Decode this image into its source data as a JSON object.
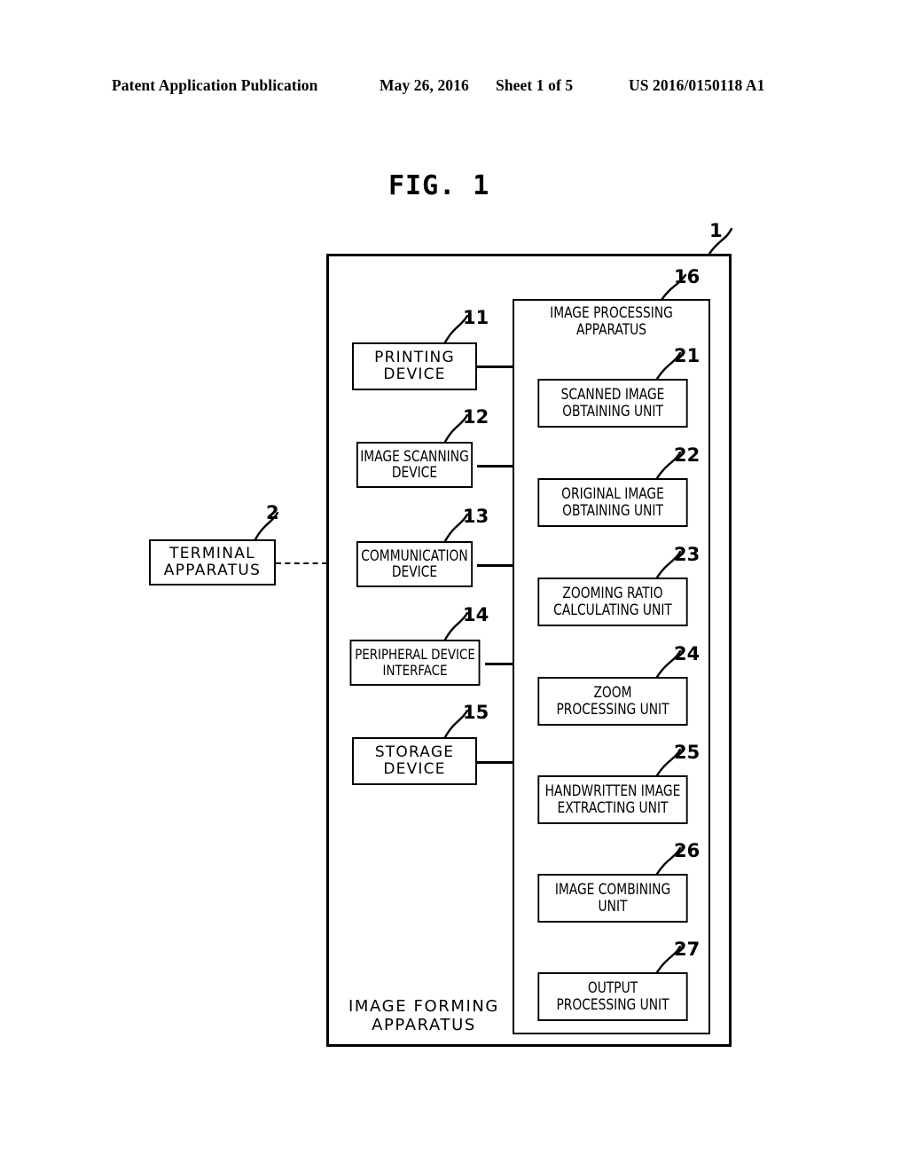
{
  "header": {
    "left": "Patent Application Publication",
    "date": "May 26, 2016",
    "sheet": "Sheet 1 of 5",
    "pub_number": "US 2016/0150118 A1"
  },
  "figure": {
    "title": "FIG. 1"
  },
  "diagram": {
    "outer": {
      "ref": "1",
      "label": "IMAGE FORMING\nAPPARATUS"
    },
    "terminal": {
      "ref": "2",
      "label": "TERMINAL\nAPPARATUS"
    },
    "image_processing_apparatus": {
      "ref": "16",
      "label": "IMAGE PROCESSING\nAPPARATUS"
    },
    "devices": [
      {
        "ref": "11",
        "label": "PRINTING\nDEVICE"
      },
      {
        "ref": "12",
        "label": "IMAGE SCANNING\nDEVICE"
      },
      {
        "ref": "13",
        "label": "COMMUNICATION\nDEVICE"
      },
      {
        "ref": "14",
        "label": "PERIPHERAL DEVICE\nINTERFACE"
      },
      {
        "ref": "15",
        "label": "STORAGE\nDEVICE"
      }
    ],
    "units": [
      {
        "ref": "21",
        "label": "SCANNED IMAGE\nOBTAINING UNIT"
      },
      {
        "ref": "22",
        "label": "ORIGINAL IMAGE\nOBTAINING UNIT"
      },
      {
        "ref": "23",
        "label": "ZOOMING RATIO\nCALCULATING UNIT"
      },
      {
        "ref": "24",
        "label": "ZOOM\nPROCESSING UNIT"
      },
      {
        "ref": "25",
        "label": "HANDWRITTEN IMAGE\nEXTRACTING UNIT"
      },
      {
        "ref": "26",
        "label": "IMAGE COMBINING\nUNIT"
      },
      {
        "ref": "27",
        "label": "OUTPUT\nPROCESSING UNIT"
      }
    ]
  },
  "colors": {
    "ink": "#000000",
    "paper": "#ffffff"
  }
}
